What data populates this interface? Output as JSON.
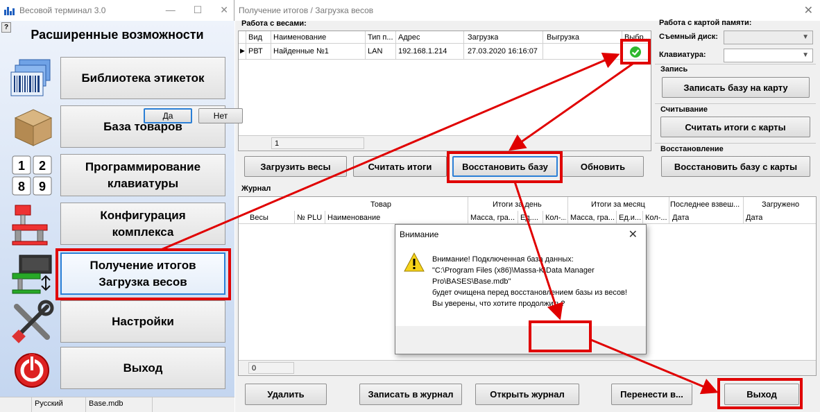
{
  "left_window": {
    "title": "Весовой терминал 3.0",
    "help": "?",
    "panel_title": "Расширенные возможности",
    "buttons": [
      {
        "label": "Библиотека этикеток"
      },
      {
        "label": "База товаров"
      },
      {
        "label": "Программирование\nклавиатуры"
      },
      {
        "label": "Конфигурация\nкомплекса"
      },
      {
        "label": "Получение итогов\nЗагрузка весов"
      },
      {
        "label": "Настройки"
      },
      {
        "label": "Выход"
      }
    ],
    "keypad_digits": [
      "1",
      "2",
      "8",
      "9"
    ],
    "status": {
      "language": "Русский",
      "database": "Base.mdb"
    }
  },
  "right_window": {
    "title": "Получение итогов / Загрузка весов",
    "scales_section": {
      "label": "Работа с весами:",
      "columns": [
        "Вид",
        "Наименование",
        "Тип п...",
        "Адрес",
        "Загрузка",
        "Выгрузка",
        "Выбр..."
      ],
      "rows": [
        {
          "kind": "РВТ",
          "name": "Найденные №1",
          "type": "LAN",
          "address": "192.168.1.214",
          "load": "27.03.2020 16:16:07",
          "unload": "",
          "selected": true
        }
      ],
      "row_count": "1"
    },
    "action_buttons": {
      "load_scales": "Загрузить весы",
      "read_totals": "Считать итоги",
      "restore_db": "Восстановить базу",
      "refresh": "Обновить"
    },
    "memory_card": {
      "label": "Работа с картой памяти:",
      "removable_disk_label": "Съемный диск:",
      "keyboard_label": "Клавиатура:",
      "write_group": "Запись",
      "write_button": "Записать базу на карту",
      "read_group": "Считывание",
      "read_button": "Считать итоги с карты",
      "restore_group": "Восстановление",
      "restore_button": "Восстановить базу с карты"
    },
    "journal": {
      "label": "Журнал",
      "group_headers": [
        "Товар",
        "Итоги за день",
        "Итоги за месяц",
        "Последнее взвеш...",
        "Загружено"
      ],
      "columns": [
        "Весы",
        "№ PLU",
        "Наименование",
        "Масса, гра...",
        "Ед....",
        "Кол-...",
        "Масса, гра...",
        "Ед.и...",
        "Кол-...",
        "Дата",
        "Дата"
      ],
      "row_count": "0"
    },
    "bottom_buttons": {
      "delete": "Удалить",
      "write_journal": "Записать в журнал",
      "open_journal": "Открыть журнал",
      "transfer": "Перенести в...",
      "exit": "Выход"
    }
  },
  "dialog": {
    "title": "Внимание",
    "message": "Внимание! Подключенная база данных:\n\"C:\\Program Files (x86)\\Massa-K\\Data Manager Pro\\BASES\\Base.mdb\"\nбудет очищена перед восстановлением базы из весов!\nВы уверены, что хотите продолжить?",
    "yes": "Да",
    "no": "Нет"
  },
  "colors": {
    "annotation_red": "#e00000",
    "focus_blue": "#2a7fd6",
    "check_green": "#2fb82f"
  }
}
